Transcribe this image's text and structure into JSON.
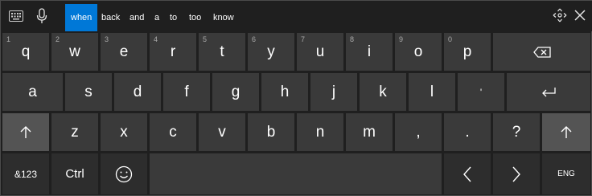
{
  "topbar": {
    "suggestions": [
      "when",
      "back",
      "and",
      "a",
      "to",
      "too",
      "know"
    ],
    "active_index": 0
  },
  "rows": {
    "row1": [
      {
        "label": "q",
        "num": "1"
      },
      {
        "label": "w",
        "num": "2"
      },
      {
        "label": "e",
        "num": "3"
      },
      {
        "label": "r",
        "num": "4"
      },
      {
        "label": "t",
        "num": "5"
      },
      {
        "label": "y",
        "num": "6"
      },
      {
        "label": "u",
        "num": "7"
      },
      {
        "label": "i",
        "num": "8"
      },
      {
        "label": "o",
        "num": "9"
      },
      {
        "label": "p",
        "num": "0"
      }
    ],
    "row2": [
      "a",
      "s",
      "d",
      "f",
      "g",
      "h",
      "j",
      "k",
      "l",
      "'"
    ],
    "row3": [
      "z",
      "x",
      "c",
      "v",
      "b",
      "n",
      "m",
      ",",
      ".",
      "?"
    ],
    "row4": {
      "symbols_label": "&123",
      "ctrl_label": "Ctrl",
      "lang_label": "ENG"
    }
  },
  "colors": {
    "accent": "#0078d7",
    "key": "#3a3a3a",
    "key_dark": "#2d2d2d",
    "shift": "#545454",
    "background": "#1f1f1f"
  },
  "icons": {
    "keyboard": "keyboard-icon",
    "mic": "microphone-icon",
    "nav": "move-keyboard-icon",
    "close": "close-icon",
    "backspace": "backspace-icon",
    "enter": "enter-icon",
    "shift": "shift-icon",
    "emoji": "emoji-icon",
    "left": "arrow-left-icon",
    "right": "arrow-right-icon"
  }
}
